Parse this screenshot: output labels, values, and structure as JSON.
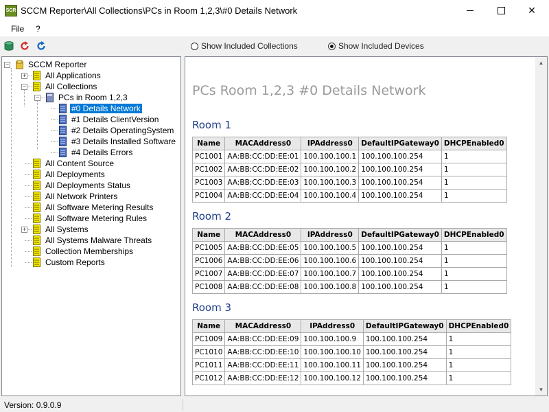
{
  "window": {
    "icon_text": "SCR",
    "title": "SCCM Reporter\\All Collections\\PCs in Room 1,2,3\\#0 Details Network",
    "close_glyph": "✕"
  },
  "menu": [
    {
      "label": "File"
    },
    {
      "label": "?"
    }
  ],
  "toolbar": {
    "radio_collections": "Show Included Collections",
    "radio_devices": "Show Included Devices",
    "selected": "devices",
    "colors": {
      "db": "#2e8b57",
      "refresh_red": "#d32f2f",
      "refresh_blue": "#1565c0"
    }
  },
  "tree": {
    "items": [
      {
        "label": "SCCM Reporter",
        "level": 0,
        "expander": "-",
        "icon": "root-icon"
      },
      {
        "label": "All Applications",
        "level": 1,
        "expander": "+",
        "icon": "report-icon"
      },
      {
        "label": "All Collections",
        "level": 1,
        "expander": "-",
        "icon": "report-icon"
      },
      {
        "label": "PCs in Room 1,2,3",
        "level": 2,
        "expander": "-",
        "icon": "collection-icon"
      },
      {
        "label": "#0 Details Network",
        "level": 3,
        "icon": "device-report-icon",
        "selected": true
      },
      {
        "label": "#1 Details ClientVersion",
        "level": 3,
        "icon": "device-report-icon"
      },
      {
        "label": "#2 Details OperatingSystem",
        "level": 3,
        "icon": "device-report-icon"
      },
      {
        "label": "#3 Details Installed Software",
        "level": 3,
        "icon": "device-report-icon"
      },
      {
        "label": "#4 Details Errors",
        "level": 3,
        "icon": "device-report-icon"
      },
      {
        "label": "All Content Source",
        "level": 1,
        "icon": "report-icon"
      },
      {
        "label": "All Deployments",
        "level": 1,
        "icon": "report-icon"
      },
      {
        "label": "All Deployments Status",
        "level": 1,
        "icon": "report-icon"
      },
      {
        "label": "All Network Printers",
        "level": 1,
        "icon": "report-icon"
      },
      {
        "label": "All Software Metering Results",
        "level": 1,
        "icon": "report-icon"
      },
      {
        "label": "All Software Metering Rules",
        "level": 1,
        "icon": "report-icon"
      },
      {
        "label": "All Systems",
        "level": 1,
        "expander": "+",
        "icon": "report-icon"
      },
      {
        "label": "All Systems Malware Threats",
        "level": 1,
        "icon": "report-icon"
      },
      {
        "label": "Collection Memberships",
        "level": 1,
        "icon": "report-icon"
      },
      {
        "label": "Custom Reports",
        "level": 1,
        "icon": "report-icon"
      }
    ]
  },
  "content": {
    "page_title": "PCs Room 1,2,3 #0 Details Network",
    "columns": [
      "Name",
      "MACAddress0",
      "IPAddress0",
      "DefaultIPGateway0",
      "DHCPEnabled0"
    ],
    "rooms": [
      {
        "heading": "Room 1",
        "rows": [
          [
            "PC1001",
            "AA:BB:CC:DD:EE:01",
            "100.100.100.1",
            "100.100.100.254",
            "1"
          ],
          [
            "PC1002",
            "AA:BB:CC:DD:EE:02",
            "100.100.100.2",
            "100.100.100.254",
            "1"
          ],
          [
            "PC1003",
            "AA:BB:CC:DD:EE:03",
            "100.100.100.3",
            "100.100.100.254",
            "1"
          ],
          [
            "PC1004",
            "AA:BB:CC:DD:EE:04",
            "100.100.100.4",
            "100.100.100.254",
            "1"
          ]
        ]
      },
      {
        "heading": "Room 2",
        "rows": [
          [
            "PC1005",
            "AA:BB:CC:DD:EE:05",
            "100.100.100.5",
            "100.100.100.254",
            "1"
          ],
          [
            "PC1006",
            "AA:BB:CC:DD:EE:06",
            "100.100.100.6",
            "100.100.100.254",
            "1"
          ],
          [
            "PC1007",
            "AA:BB:CC:DD:EE:07",
            "100.100.100.7",
            "100.100.100.254",
            "1"
          ],
          [
            "PC1008",
            "AA:BB:CC:DD:EE:08",
            "100.100.100.8",
            "100.100.100.254",
            "1"
          ]
        ]
      },
      {
        "heading": "Room 3",
        "rows": [
          [
            "PC1009",
            "AA:BB:CC:DD:EE:09",
            "100.100.100.9",
            "100.100.100.254",
            "1"
          ],
          [
            "PC1010",
            "AA:BB:CC:DD:EE:10",
            "100.100.100.10",
            "100.100.100.254",
            "1"
          ],
          [
            "PC1011",
            "AA:BB:CC:DD:EE:11",
            "100.100.100.11",
            "100.100.100.254",
            "1"
          ],
          [
            "PC1012",
            "AA:BB:CC:DD:EE:12",
            "100.100.100.12",
            "100.100.100.254",
            "1"
          ]
        ]
      }
    ]
  },
  "status": {
    "version": "Version: 0.9.0.9"
  }
}
